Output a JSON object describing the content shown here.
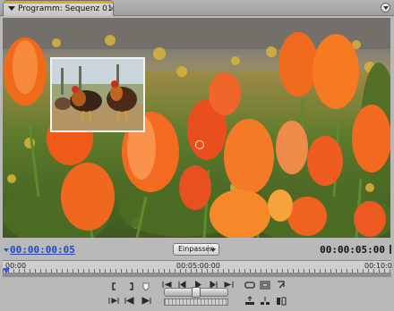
{
  "panel": {
    "tab_title": "Programm: Sequenz 01",
    "tab_close": "×"
  },
  "monitor": {
    "current_timecode": "00:00:00:05",
    "zoom_label": "Einpassen",
    "duration_timecode": "00:00:05:00"
  },
  "ruler": {
    "labels": [
      "00:00",
      "00:05:00:00",
      "00:10:0"
    ]
  },
  "transport": {
    "icons": [
      "mark-in-icon",
      "mark-out-icon",
      "set-marker-icon",
      "go-to-in-icon",
      "step-back-icon",
      "play-icon",
      "step-forward-icon",
      "go-to-out-icon",
      "loop-icon",
      "safe-margins-icon",
      "output-icon",
      "play-in-to-out-icon",
      "go-to-previous-edit-icon",
      "go-to-next-edit-icon",
      "lift-icon",
      "extract-icon",
      "trim-icon"
    ]
  },
  "colors": {
    "accent_tab": "#e0a82a",
    "timecode_blue": "#2848b8",
    "playhead": "#2d5bd8"
  }
}
